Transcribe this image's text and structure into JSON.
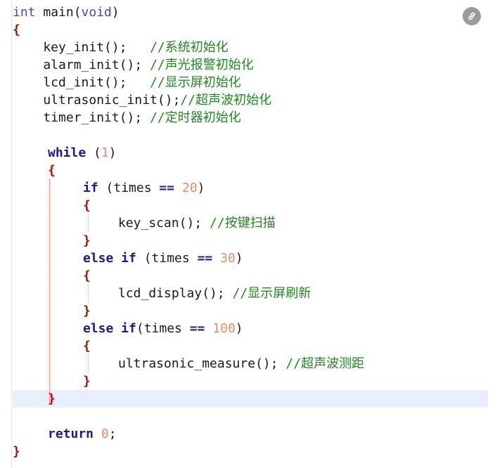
{
  "code": {
    "l1": {
      "type": "int",
      "name": " main(",
      "param": "void",
      "close": ")"
    },
    "l2": {
      "brace": "{"
    },
    "l3": {
      "code": "    key_init();   ",
      "comment": "//系统初始化"
    },
    "l4": {
      "code": "    alarm_init(); ",
      "comment": "//声光报警初始化"
    },
    "l5": {
      "code": "    lcd_init();   ",
      "comment": "//显示屏初始化"
    },
    "l6": {
      "code": "    ultrasonic_init();",
      "comment": "//超声波初始化"
    },
    "l7": {
      "code": "    timer_init(); ",
      "comment": "//定时器初始化"
    },
    "l9": {
      "kw": "while",
      "open": " (",
      "num": "1",
      "close": ")"
    },
    "l10": {
      "brace": "{"
    },
    "l11": {
      "kw": "if",
      "open": " (times ",
      "op": "==",
      "sp": " ",
      "num": "20",
      "close": ")"
    },
    "l12": {
      "brace": "{"
    },
    "l13": {
      "code": "key_scan(); ",
      "comment": "//按键扫描"
    },
    "l14": {
      "brace": "}"
    },
    "l15": {
      "kw": "else if",
      "open": " (times ",
      "op": "==",
      "sp": " ",
      "num": "30",
      "close": ")"
    },
    "l16": {
      "brace": "{"
    },
    "l17": {
      "code": "lcd_display(); ",
      "comment": "//显示屏刷新"
    },
    "l18": {
      "brace": "}"
    },
    "l19": {
      "kw": "else if",
      "open": "(times ",
      "op": "==",
      "sp": " ",
      "num": "100",
      "close": ")"
    },
    "l20": {
      "brace": "{"
    },
    "l21": {
      "code": "ultrasonic_measure(); ",
      "comment": "//超声波测距"
    },
    "l22": {
      "brace": "}"
    },
    "l23": {
      "brace": "}"
    },
    "l25": {
      "kw": "return",
      "sp": " ",
      "num": "0",
      "end": ";"
    },
    "l26": {
      "brace": "}"
    }
  },
  "corner_button": {
    "icon": "link-icon"
  },
  "colors": {
    "keyword": "#1c1c90",
    "number": "#e0906a",
    "comment": "#1e8a1e",
    "brace": "#8a1f0f",
    "highlight": "#e8eefb"
  }
}
